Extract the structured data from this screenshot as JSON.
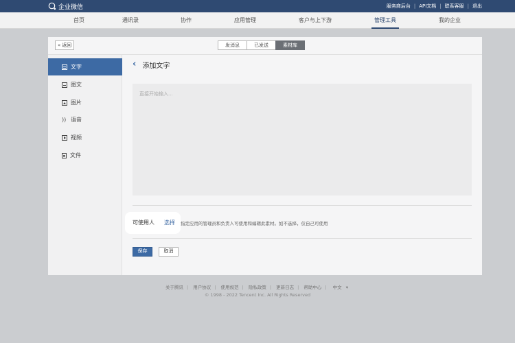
{
  "topbar": {
    "logo_text": "企业微信",
    "links": [
      "服务商后台",
      "API文档",
      "联系客服",
      "退出"
    ]
  },
  "nav": {
    "items": [
      "首页",
      "通讯录",
      "协作",
      "应用管理",
      "客户与上下游",
      "管理工具",
      "我的企业"
    ],
    "active": "管理工具"
  },
  "card": {
    "back_label": "返回",
    "tabs": [
      "发消息",
      "已发送",
      "素材库"
    ],
    "active_tab": "素材库"
  },
  "sidebar": {
    "items": [
      "文字",
      "图文",
      "图片",
      "语音",
      "视频",
      "文件"
    ],
    "active": "文字"
  },
  "content": {
    "title": "添加文字",
    "editor_placeholder": "直接开始输入...",
    "permission_label": "可使用人",
    "permission_select": "选择",
    "permission_hint": "指定应用的管理员和负责人可使用和编辑此素材。如不选择，仅自己可使用",
    "save_label": "保存",
    "cancel_label": "取消"
  },
  "footer": {
    "links": [
      "关于腾讯",
      "用户协议",
      "使用规范",
      "隐私政策",
      "更新日志",
      "帮助中心",
      "中文"
    ],
    "language_arrow": "▾",
    "copyright": "© 1998 - 2022 Tencent Inc. All Rights Reserved"
  }
}
